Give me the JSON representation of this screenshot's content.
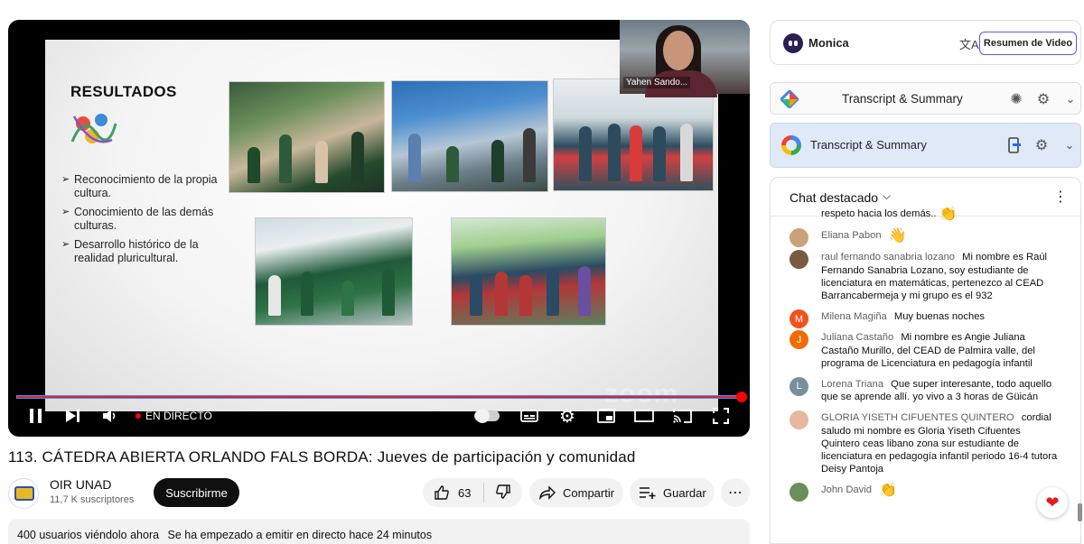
{
  "player": {
    "slide": {
      "title": "RESULTADOS",
      "bullets": [
        "Reconocimiento de la propia cultura.",
        "Conocimiento de las  demás culturas.",
        "Desarrollo histórico de la realidad pluricultural."
      ]
    },
    "participant_name": "Yahen Sando...",
    "watermark": "zoom",
    "controls": {
      "live_label": "EN DIRECTO",
      "progress": 1.0,
      "icons": [
        "pause-icon",
        "next-icon",
        "volume-icon",
        "autoplay-toggle",
        "captions-icon",
        "gear-icon",
        "miniplayer-icon",
        "theater-icon",
        "cast-icon",
        "fullscreen-icon"
      ]
    }
  },
  "video": {
    "title": "113. CÁTEDRA ABIERTA ORLANDO FALS BORDA: Jueves de participación y comunidad",
    "channel_name": "OIR UNAD",
    "subscribers": "11,7 K suscriptores",
    "subscribe_label": "Suscribirme",
    "likes": "63",
    "share_label": "Compartir",
    "save_label": "Guardar",
    "viewers": "400 usuarios viéndolo ahora",
    "started": "Se ha empezado a emitir en directo hace 24 minutos"
  },
  "sidebar": {
    "monica": {
      "name": "Monica",
      "summary_button": "Resumen de Video"
    },
    "transcript_1": {
      "label": "Transcript & Summary"
    },
    "transcript_2": {
      "label": "Transcript & Summary"
    },
    "chat": {
      "title": "Chat destacado",
      "messages": [
        {
          "author": "",
          "text": "respeto hacia los demás..",
          "emoji": "👏",
          "avatar": "",
          "avatar_color": "#ffffff"
        },
        {
          "author": "Eliana Pabon",
          "text": "",
          "emoji": "👋",
          "avatar": "",
          "avatar_color": "#c9a27a"
        },
        {
          "author": "raul fernando sanabria lozano",
          "text": "Mi nombre es Raúl Fernando Sanabria Lozano, soy estudiante de licenciatura en matemáticas, pertenezco al CEAD Barrancabermeja y mi grupo es el 932",
          "emoji": "",
          "avatar": "",
          "avatar_color": "#7a5a40"
        },
        {
          "author": "Milena Magiña",
          "text": "Muy buenas noches",
          "emoji": "",
          "avatar": "M",
          "avatar_color": "#f4511e"
        },
        {
          "author": "Juliana Castaño",
          "text": "Mi nombre es Angie Juliana Castaño Murillo, del CEAD de Palmira valle, del programa de Licenciatura en pedagogía infantil",
          "emoji": "",
          "avatar": "J",
          "avatar_color": "#ef6c00"
        },
        {
          "author": "Lorena Triana",
          "text": "Que super interesante, todo aquello que se aprende allí. yo vivo a 3 horas de Güicán",
          "emoji": "",
          "avatar": "L",
          "avatar_color": "#78909c"
        },
        {
          "author": "GLORIA YISETH CIFUENTES QUINTERO",
          "text": "cordial saludo mi nombre es Gloria Yiseth Cifuentes Quintero ceas libano zona sur estudiante de licenciatura en pedagogía infantil periodo 16-4 tutora Deisy Pantoja",
          "emoji": "",
          "avatar": "",
          "avatar_color": "#e8b7a0"
        },
        {
          "author": "John David",
          "text": "",
          "emoji": "👏",
          "avatar": "",
          "avatar_color": "#6b8e5a"
        }
      ]
    }
  },
  "colors": {
    "accent_red": "#ff0000",
    "monica_border": "#6b4bff",
    "google_panel": "#dfe9f7"
  }
}
